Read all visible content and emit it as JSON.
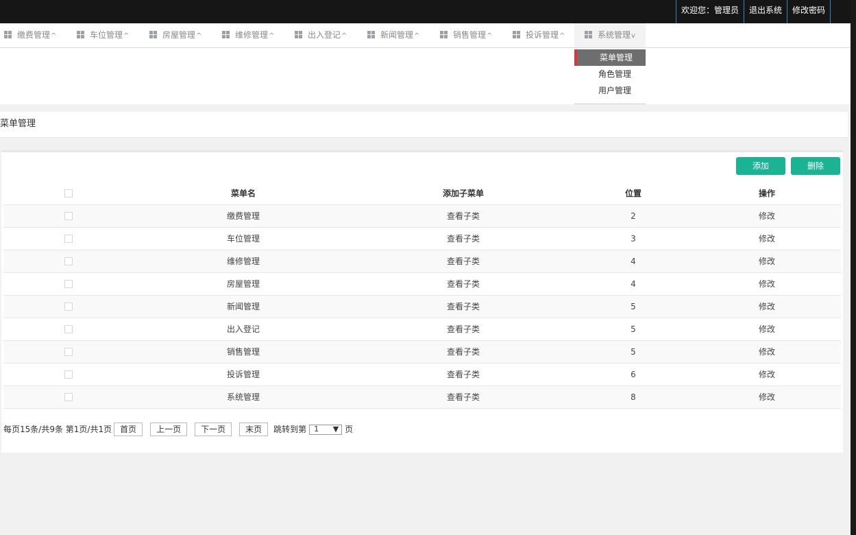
{
  "topbar": {
    "welcome": "欢迎您：管理员",
    "logout": "退出系统",
    "change_password": "修改密码"
  },
  "nav": {
    "items": [
      {
        "label": "缴费管理",
        "caret": "^"
      },
      {
        "label": "车位管理",
        "caret": "^"
      },
      {
        "label": "房屋管理",
        "caret": "^"
      },
      {
        "label": "维修管理",
        "caret": "^"
      },
      {
        "label": "出入登记",
        "caret": "^"
      },
      {
        "label": "新闻管理",
        "caret": "^"
      },
      {
        "label": "销售管理",
        "caret": "^"
      },
      {
        "label": "投诉管理",
        "caret": "^"
      },
      {
        "label": "系统管理",
        "caret": "v"
      }
    ],
    "dropdown": [
      "菜单管理",
      "角色管理",
      "用户管理"
    ]
  },
  "breadcrumb": "菜单管理",
  "toolbar": {
    "add": "添加",
    "delete": "删除"
  },
  "table": {
    "headers": [
      "菜单名",
      "添加子菜单",
      "位置",
      "操作"
    ],
    "rows": [
      {
        "name": "缴费管理",
        "sub": "查看子类",
        "pos": "2",
        "op": "修改"
      },
      {
        "name": "车位管理",
        "sub": "查看子类",
        "pos": "3",
        "op": "修改"
      },
      {
        "name": "维修管理",
        "sub": "查看子类",
        "pos": "4",
        "op": "修改"
      },
      {
        "name": "房屋管理",
        "sub": "查看子类",
        "pos": "4",
        "op": "修改"
      },
      {
        "name": "新闻管理",
        "sub": "查看子类",
        "pos": "5",
        "op": "修改"
      },
      {
        "name": "出入登记",
        "sub": "查看子类",
        "pos": "5",
        "op": "修改"
      },
      {
        "name": "销售管理",
        "sub": "查看子类",
        "pos": "5",
        "op": "修改"
      },
      {
        "name": "投诉管理",
        "sub": "查看子类",
        "pos": "6",
        "op": "修改"
      },
      {
        "name": "系统管理",
        "sub": "查看子类",
        "pos": "8",
        "op": "修改"
      }
    ]
  },
  "pager": {
    "summary": "每页15条/共9条 第1页/共1页",
    "first": "首页",
    "prev": "上一页",
    "next": "下一页",
    "last": "末页",
    "jump_label": "跳转到第",
    "page_value": "1",
    "page_suffix": "页"
  }
}
